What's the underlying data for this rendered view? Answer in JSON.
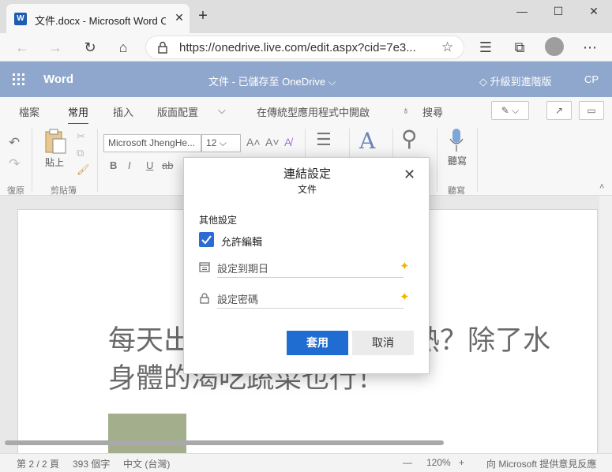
{
  "browser": {
    "tab_title": "文件.docx - Microsoft Word Online",
    "tab_icon_letter": "W",
    "url": "https://onedrive.live.com/edit.aspx?cid=7e3..."
  },
  "word_header": {
    "app_name": "Word",
    "doc_status": "文件 - 已儲存至 OneDrive ⌵",
    "upgrade": "升級到進階版",
    "user_initials": "CP"
  },
  "ribbon": {
    "tabs": [
      "檔案",
      "常用",
      "插入",
      "版面配置",
      "⌵",
      "在傳統型應用程式中開啟",
      "搜尋"
    ],
    "active_tab": "常用",
    "font_name": "Microsoft JhengHe...",
    "font_size": "12",
    "paste_label": "貼上",
    "clipboard_label": "剪貼簿",
    "undo_label": "復原",
    "dictate_label": "聽寫",
    "dictate_group": "聽寫",
    "format_buttons": [
      "B",
      "I",
      "U",
      "ab"
    ],
    "grow_font": "A˄",
    "shrink_font": "A˅"
  },
  "document": {
    "heading_line1": "每天出門前做好防曬，怕熱？除了水",
    "heading_line2": "身體的渴吃蔬菜也行！"
  },
  "dialog": {
    "title": "連結設定",
    "subtitle": "文件",
    "section_label": "其他設定",
    "allow_edit_label": "允許編輯",
    "allow_edit_checked": true,
    "expiry_placeholder": "設定到期日",
    "password_placeholder": "設定密碼",
    "apply_label": "套用",
    "cancel_label": "取消"
  },
  "statusbar": {
    "page": "第 2 / 2 頁",
    "words": "393 個字",
    "language": "中文 (台灣)",
    "zoom_minus": "—",
    "zoom": "120%",
    "zoom_plus": "+",
    "feedback": "向 Microsoft 提供意見反應"
  },
  "colors": {
    "word_header": "#8fa7cd",
    "accent": "#1f6dd1",
    "sparkle": "#f4b400"
  }
}
